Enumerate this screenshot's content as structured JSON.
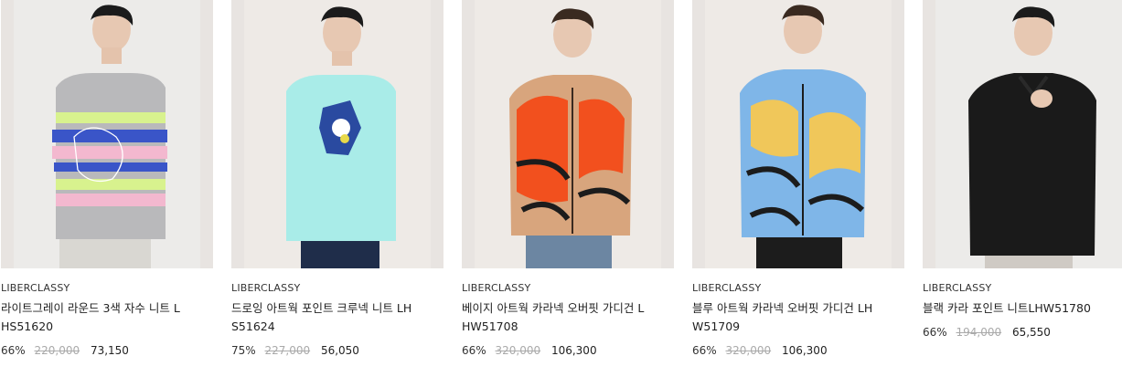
{
  "products": [
    {
      "brand": "LIBERCLASSY",
      "name": "라이트그레이 라운드 3색 자수 니트 LHS51620",
      "discount": "66%",
      "original_price": "220,000",
      "price": "73,150",
      "image_icon": "product-photo-grey-striped-knit",
      "colors": {
        "bg": "#ecebe9",
        "garment": "#b9b9bb",
        "stripe1": "#3a55c8",
        "stripe2": "#f3b8cf",
        "stripe3": "#d8f28e"
      }
    },
    {
      "brand": "LIBERCLASSY",
      "name": "드로잉 아트웍 포인트 크루넥 니트 LHS51624",
      "discount": "75%",
      "original_price": "227,000",
      "price": "56,050",
      "image_icon": "product-photo-mint-artwork-knit",
      "colors": {
        "bg": "#eeeae6",
        "garment": "#a9ece8",
        "stripe1": "#2a4aa0",
        "stripe2": "#ffffff",
        "stripe3": "#e8d94a"
      }
    },
    {
      "brand": "LIBERCLASSY",
      "name": "베이지 아트웍 카라넥 오버핏 가디건 LHW51708",
      "discount": "66%",
      "original_price": "320,000",
      "price": "106,300",
      "image_icon": "product-photo-orange-cardigan",
      "colors": {
        "bg": "#eeeae6",
        "garment": "#d8a57d",
        "stripe1": "#f2501e",
        "stripe2": "#1c1c1c",
        "stripe3": "#f6efe4"
      }
    },
    {
      "brand": "LIBERCLASSY",
      "name": "블루 아트웍 카라넥 오버핏 가디건 LHW51709",
      "discount": "66%",
      "original_price": "320,000",
      "price": "106,300",
      "image_icon": "product-photo-blue-cardigan",
      "colors": {
        "bg": "#eeeae6",
        "garment": "#7fb6e8",
        "stripe1": "#f0c75a",
        "stripe2": "#1c1c1c",
        "stripe3": "#5b8fd4"
      }
    },
    {
      "brand": "LIBERCLASSY",
      "name": "블랙 카라 포인트 니트LHW51780",
      "discount": "66%",
      "original_price": "194,000",
      "price": "65,550",
      "image_icon": "product-photo-black-collar-knit",
      "colors": {
        "bg": "#ecebe9",
        "garment": "#1a1a1a",
        "stripe1": "#2a2a2a",
        "stripe2": "#2a2a2a",
        "stripe3": "#333333"
      }
    }
  ]
}
